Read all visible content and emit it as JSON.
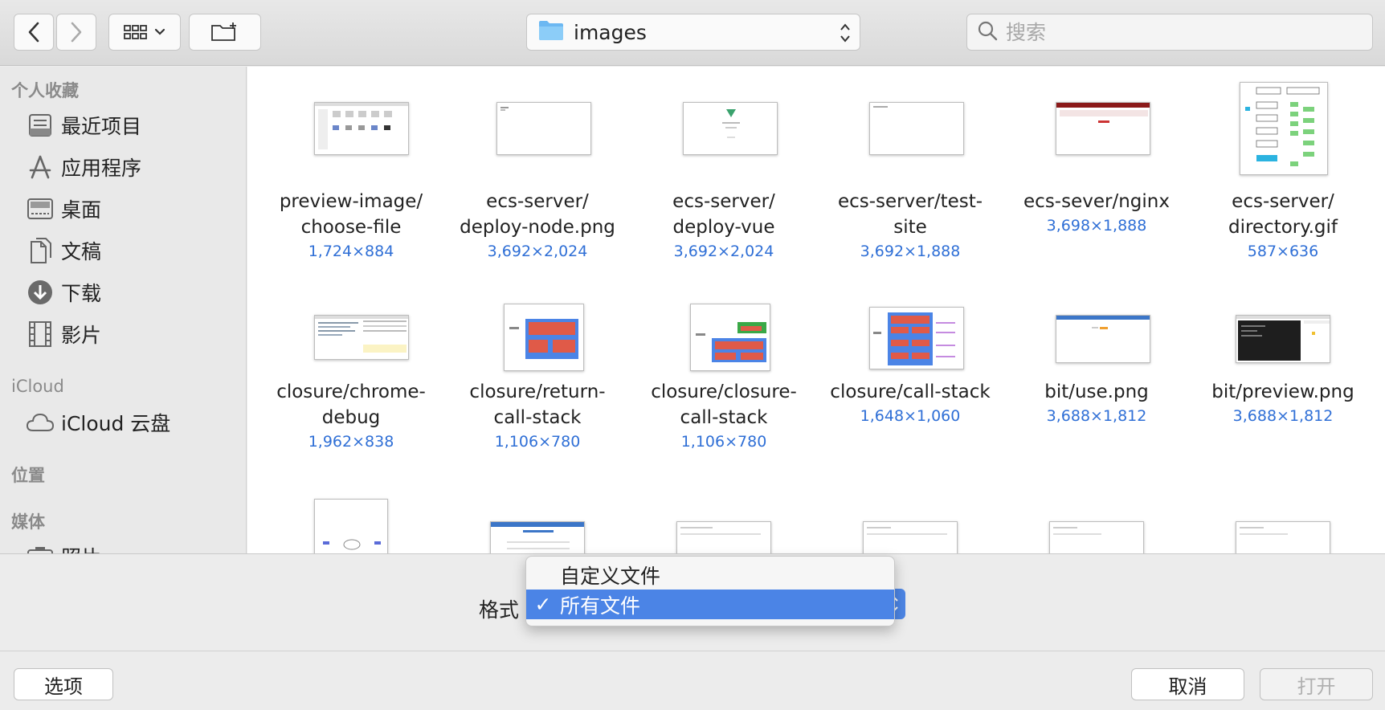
{
  "toolbar": {
    "back": "back-icon",
    "forward": "forward-icon",
    "view_mode": "icon-grid-view-icon",
    "new_folder": "new-folder-icon",
    "location": "images",
    "search_placeholder": "搜索"
  },
  "sidebar": {
    "favorites_title": "个人收藏",
    "favorites": [
      {
        "label": "最近项目",
        "icon": "recents-icon"
      },
      {
        "label": "应用程序",
        "icon": "applications-icon"
      },
      {
        "label": "桌面",
        "icon": "desktop-icon"
      },
      {
        "label": "文稿",
        "icon": "documents-icon"
      },
      {
        "label": "下载",
        "icon": "downloads-icon"
      },
      {
        "label": "影片",
        "icon": "movies-icon"
      }
    ],
    "icloud_title": "iCloud",
    "icloud_drive": "iCloud 云盘",
    "locations_title": "位置",
    "media_title": "媒体",
    "media_partial": "照片"
  },
  "files": [
    {
      "name1": "preview-image/",
      "name2": "choose-file",
      "dim": "1,724×884"
    },
    {
      "name1": "ecs-server/",
      "name2": "deploy-node.png",
      "dim": "3,692×2,024"
    },
    {
      "name1": "ecs-server/",
      "name2": "deploy-vue",
      "dim": "3,692×2,024"
    },
    {
      "name1": "ecs-server/test-",
      "name2": "site",
      "dim": "3,692×1,888"
    },
    {
      "name1": "ecs-sever/nginx",
      "name2": "",
      "dim": "3,698×1,888"
    },
    {
      "name1": "ecs-server/",
      "name2": "directory.gif",
      "dim": "587×636"
    },
    {
      "name1": "closure/chrome-",
      "name2": "debug",
      "dim": "1,962×838"
    },
    {
      "name1": "closure/return-",
      "name2": "call-stack",
      "dim": "1,106×780"
    },
    {
      "name1": "closure/closure-",
      "name2": "call-stack",
      "dim": "1,106×780"
    },
    {
      "name1": "closure/call-stack",
      "name2": "",
      "dim": "1,648×1,060"
    },
    {
      "name1": "bit/use.png",
      "name2": "",
      "dim": "3,688×1,812"
    },
    {
      "name1": "bit/preview.png",
      "name2": "",
      "dim": "3,688×1,812"
    }
  ],
  "format": {
    "label": "格式",
    "options": [
      "自定义文件",
      "所有文件"
    ],
    "selected_check": "✓"
  },
  "footer": {
    "options_label": "选项",
    "cancel_label": "取消",
    "open_label": "打开"
  },
  "colors": {
    "accent": "#4b84e6",
    "dimension_text": "#2f6fd6"
  }
}
